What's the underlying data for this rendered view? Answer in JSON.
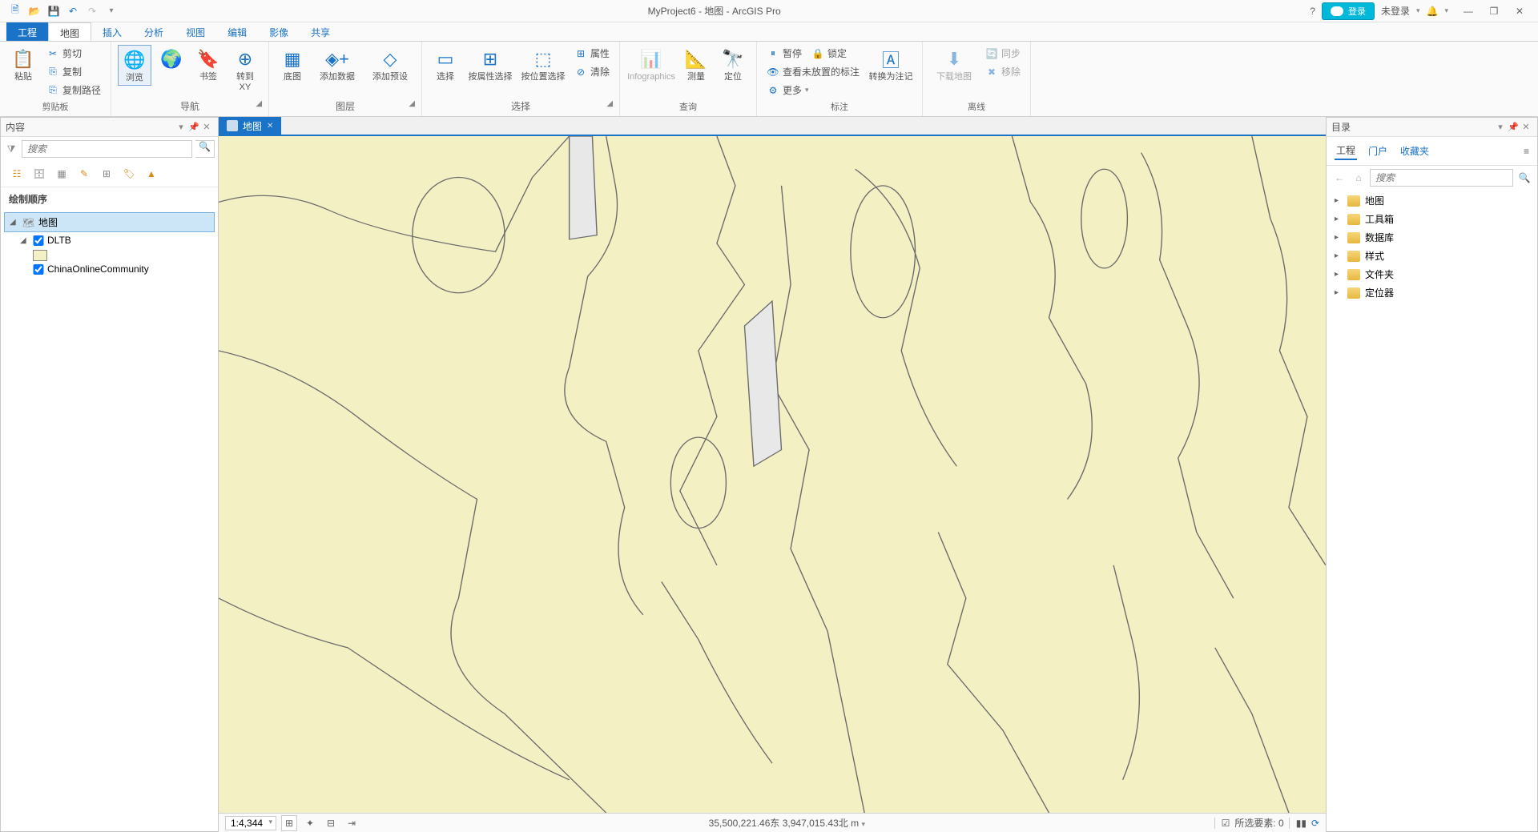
{
  "app": {
    "title": "MyProject6 - 地图 - ArcGIS Pro",
    "not_logged": "未登录",
    "help_sym": "?"
  },
  "qat": [
    "新建",
    "打开",
    "保存",
    "撤销",
    "重做"
  ],
  "ribbon_tabs": {
    "file": "工程",
    "items": [
      "地图",
      "插入",
      "分析",
      "视图",
      "编辑",
      "影像",
      "共享"
    ],
    "active": "地图"
  },
  "ribbon_groups": {
    "clipboard": {
      "label": "剪贴板",
      "paste": "粘贴",
      "cut": "剪切",
      "copy": "复制",
      "copypath": "复制路径"
    },
    "navigate": {
      "label": "导航",
      "explore": "浏览",
      "bookmarks": "书签",
      "goto": "转到\nXY"
    },
    "layer": {
      "label": "图层",
      "basemap": "底图",
      "adddata": "添加数据",
      "addpreset": "添加预设"
    },
    "selection": {
      "label": "选择",
      "select": "选择",
      "byattr": "按属性选择",
      "byloc": "按位置选择",
      "attributes": "属性",
      "clear": "清除"
    },
    "inquiry": {
      "label": "查询",
      "infographics": "Infographics",
      "measure": "测量",
      "locate": "定位"
    },
    "labeling": {
      "label": "标注",
      "pause": "暂停",
      "lock": "锁定",
      "viewunplaced": "查看未放置的标注",
      "more": "更多",
      "convert": "转换为注记"
    },
    "offline": {
      "label": "离线",
      "download": "下载地图",
      "sync": "同步",
      "remove": "移除"
    }
  },
  "contents": {
    "title": "内容",
    "search_ph": "搜索",
    "section": "绘制顺序",
    "map": "地图",
    "layers": [
      {
        "name": "DLTB",
        "checked": true,
        "expanded": true,
        "has_swatch": true
      },
      {
        "name": "ChinaOnlineCommunity",
        "checked": true,
        "expanded": false,
        "has_swatch": false
      }
    ]
  },
  "catalog": {
    "title": "目录",
    "tabs": {
      "project": "工程",
      "portal": "门户",
      "favorites": "收藏夹",
      "active": "工程"
    },
    "search_ph": "搜索",
    "items": [
      "地图",
      "工具箱",
      "数据库",
      "样式",
      "文件夹",
      "定位器"
    ]
  },
  "view_tab": {
    "label": "地图"
  },
  "status": {
    "scale": "1:4,344",
    "coords": "35,500,221.46东 3,947,015.43北 m",
    "selected": "所选要素: 0"
  },
  "colors": {
    "accent": "#1a73c7",
    "polygon_fill": "#f3f0c4",
    "polygon_stroke": "#6b6b6b"
  }
}
